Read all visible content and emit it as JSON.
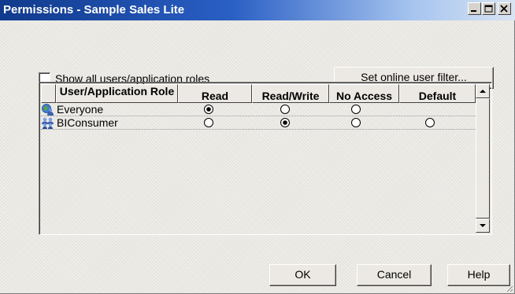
{
  "window": {
    "title": "Permissions - Sample Sales Lite"
  },
  "options": {
    "show_all_label": "Show all users/application roles",
    "show_all_checked": false,
    "filter_button": "Set online user filter..."
  },
  "grid": {
    "columns": [
      "User/Application Role",
      "Read",
      "Read/Write",
      "No Access",
      "Default"
    ],
    "rows": [
      {
        "name": "Everyone",
        "icon": "group-globe-icon",
        "selected": "Read",
        "default_available": false
      },
      {
        "name": "BIConsumer",
        "icon": "group-users-icon",
        "selected": "Read/Write",
        "default_available": true
      }
    ]
  },
  "footer": {
    "ok": "OK",
    "cancel": "Cancel",
    "help": "Help"
  },
  "colors": {
    "title_bar_start": "#103a8c",
    "title_bar_end": "#d9e4f3",
    "dialog_bg": "#ebe9e4"
  }
}
